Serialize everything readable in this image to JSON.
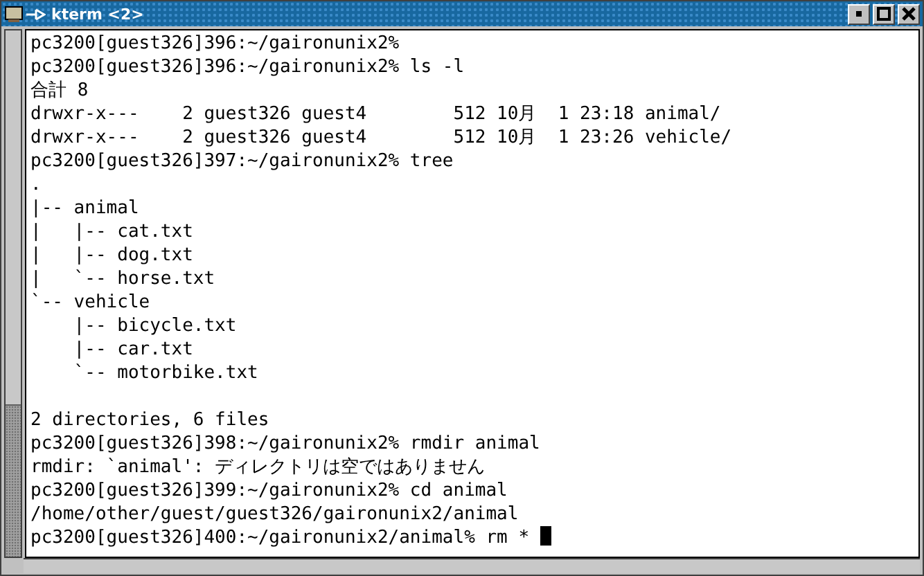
{
  "window": {
    "title": "kterm <2>"
  },
  "terminal": {
    "lines": [
      {
        "text": "pc3200[guest326]396:~/gaironunix2%"
      },
      {
        "text": "pc3200[guest326]396:~/gaironunix2% ls -l"
      },
      {
        "text": "合計 8"
      },
      {
        "text": "drwxr-x---    2 guest326 guest4        512 10月  1 23:18 animal/"
      },
      {
        "text": "drwxr-x---    2 guest326 guest4        512 10月  1 23:26 vehicle/"
      },
      {
        "text": "pc3200[guest326]397:~/gaironunix2% tree"
      },
      {
        "text": "."
      },
      {
        "text": "|-- animal"
      },
      {
        "text": "|   |-- cat.txt"
      },
      {
        "text": "|   |-- dog.txt"
      },
      {
        "text": "|   `-- horse.txt"
      },
      {
        "text": "`-- vehicle"
      },
      {
        "text": "    |-- bicycle.txt"
      },
      {
        "text": "    |-- car.txt"
      },
      {
        "text": "    `-- motorbike.txt"
      },
      {
        "text": "2 directories, 6 files",
        "blank_before": true
      },
      {
        "text": "pc3200[guest326]398:~/gaironunix2% rmdir animal"
      },
      {
        "text": "rmdir: `animal': ディレクトリは空ではありません"
      },
      {
        "text": "pc3200[guest326]399:~/gaironunix2% cd animal"
      },
      {
        "text": "/home/other/guest/guest326/gaironunix2/animal"
      },
      {
        "text": "pc3200[guest326]400:~/gaironunix2/animal% rm *"
      }
    ],
    "cursor": true
  }
}
